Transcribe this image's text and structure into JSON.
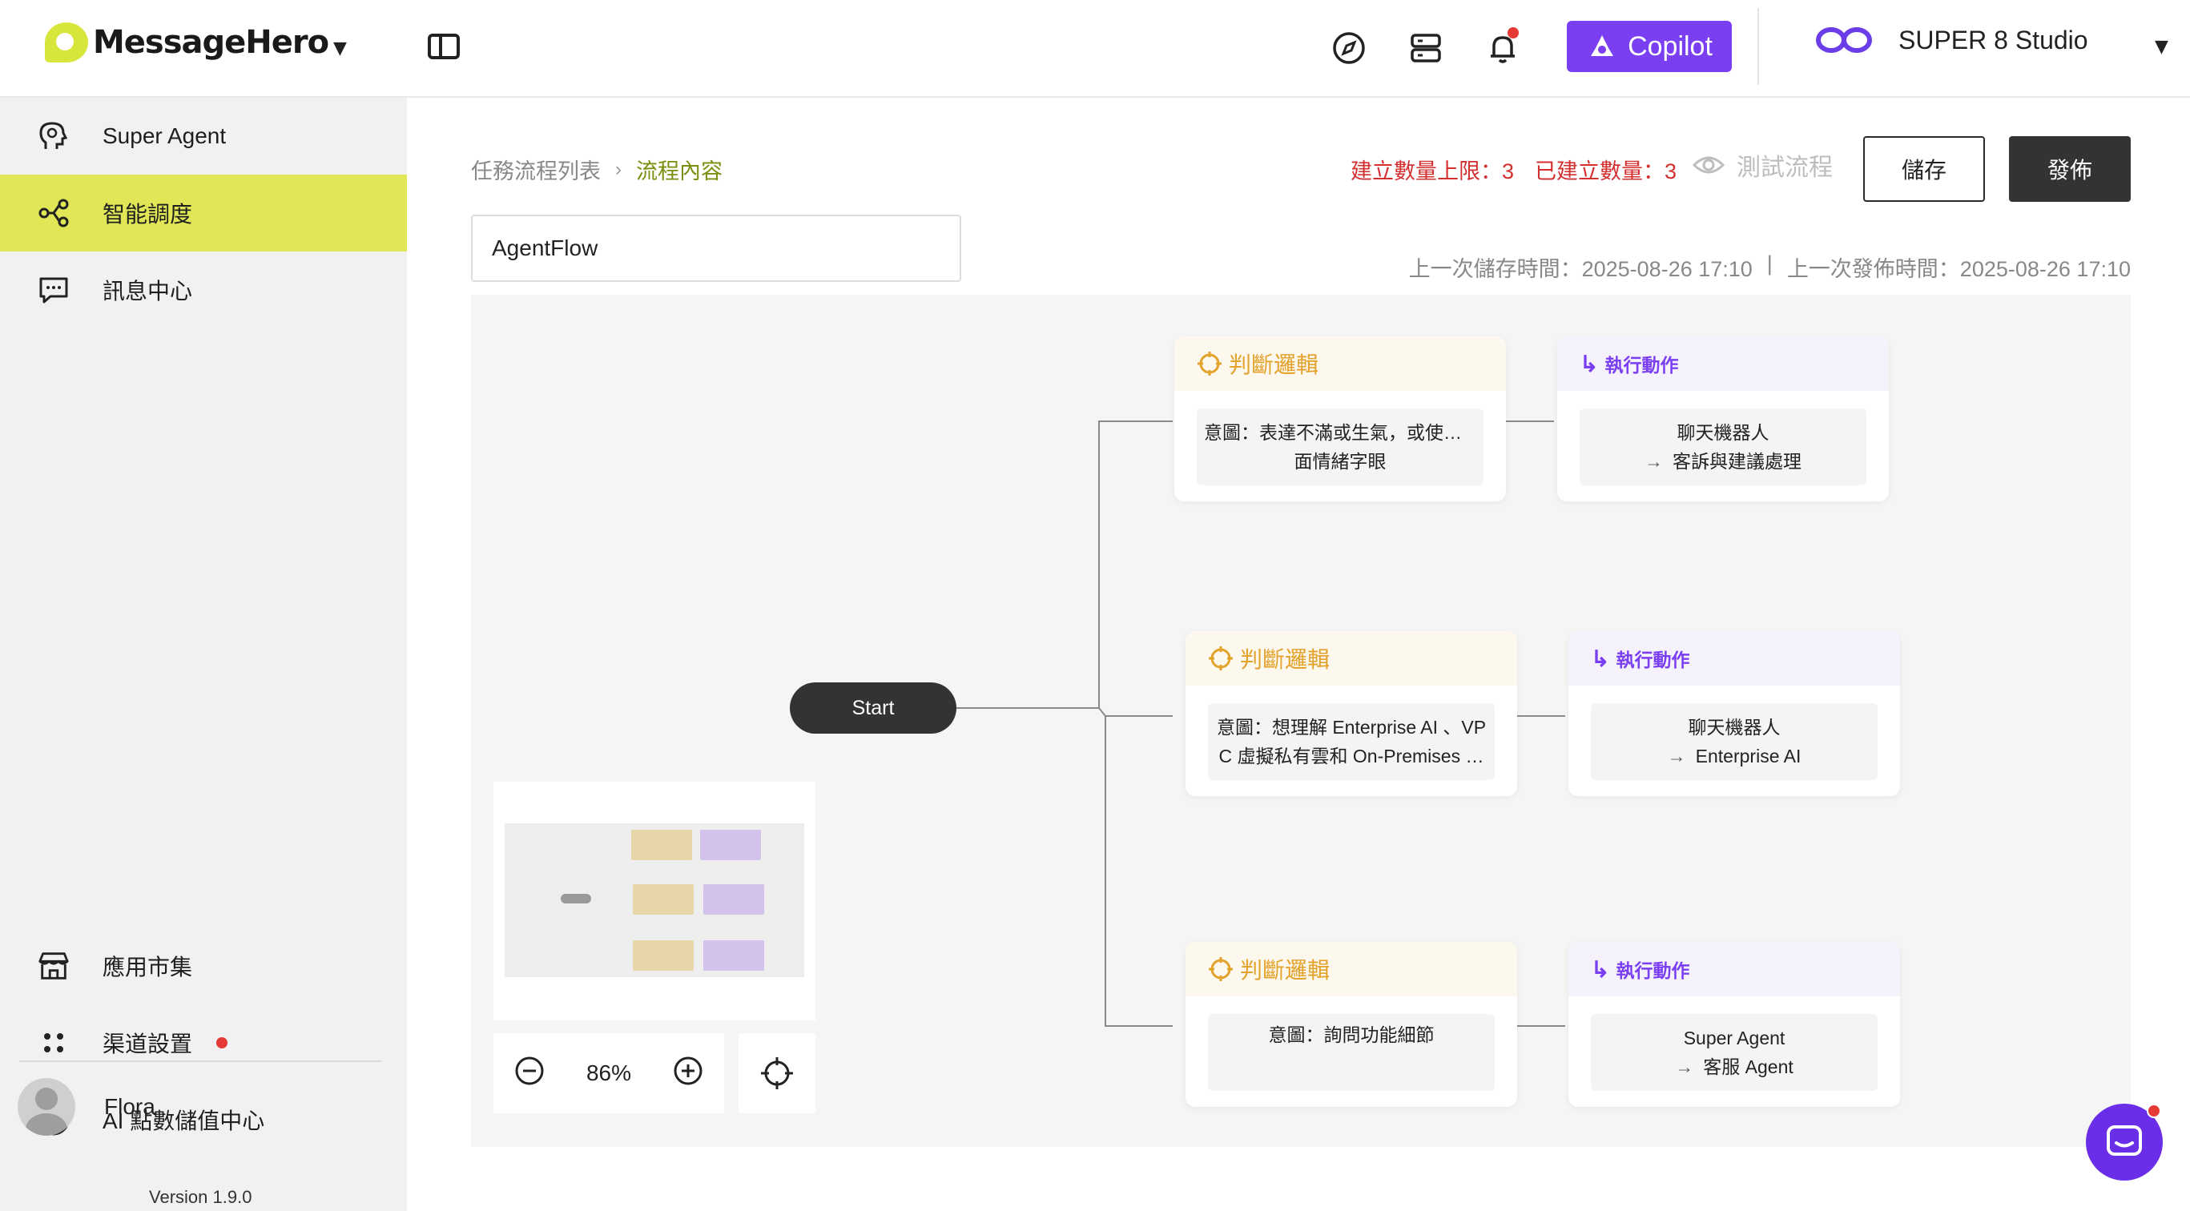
{
  "app": {
    "brand": "MessageHero",
    "copilot_label": "Copilot",
    "studio_name": "SUPER 8 Studio"
  },
  "sidebar": {
    "items": [
      {
        "label": "Super Agent",
        "icon": "brain-icon"
      },
      {
        "label": "智能調度",
        "icon": "flow-icon",
        "active": true
      },
      {
        "label": "訊息中心",
        "icon": "chat-icon"
      },
      {
        "label": "應用市集",
        "icon": "store-icon"
      },
      {
        "label": "渠道設置",
        "icon": "dots-icon",
        "badge": true
      },
      {
        "label": "AI 點數儲值中心",
        "icon": "copyright-icon"
      }
    ],
    "user_name": "Flora",
    "version": "Version 1.9.0"
  },
  "header": {
    "breadcrumb_parent": "任務流程列表",
    "breadcrumb_current": "流程內容",
    "limit_text": "建立數量上限：3",
    "created_text": "已建立數量：3",
    "test_label": "測試流程",
    "save_label": "儲存",
    "publish_label": "發佈",
    "flow_name": "AgentFlow",
    "last_saved": "上一次儲存時間：2025-08-26 17:10",
    "separator": "|",
    "last_published": "上一次發佈時間：2025-08-26 17:10"
  },
  "canvas": {
    "start_label": "Start",
    "logic_title": "判斷邏輯",
    "action_title": "執行動作",
    "rows": [
      {
        "logic_line1": "意圖：表達不滿或生氣，或使用負",
        "logic_line2": "面情緒字眼",
        "action_line1": "聊天機器人",
        "action_line2": "客訴與建議處理"
      },
      {
        "logic_line1": "意圖：想理解 Enterprise AI 、VP",
        "logic_line2": "C 虛擬私有雲和 On-Premises …",
        "action_line1": "聊天機器人",
        "action_line2": "Enterprise AI"
      },
      {
        "logic_line1": "意圖：詢問功能細節",
        "logic_line2": "",
        "action_line1": "Super Agent",
        "action_line2": "客服 Agent"
      }
    ],
    "zoom": "86%"
  },
  "colors": {
    "accent": "#e0e656",
    "copilot": "#7b3ff2",
    "logic": "#e3a22b",
    "action": "#7b3ff2",
    "alert": "#d32f2f"
  }
}
